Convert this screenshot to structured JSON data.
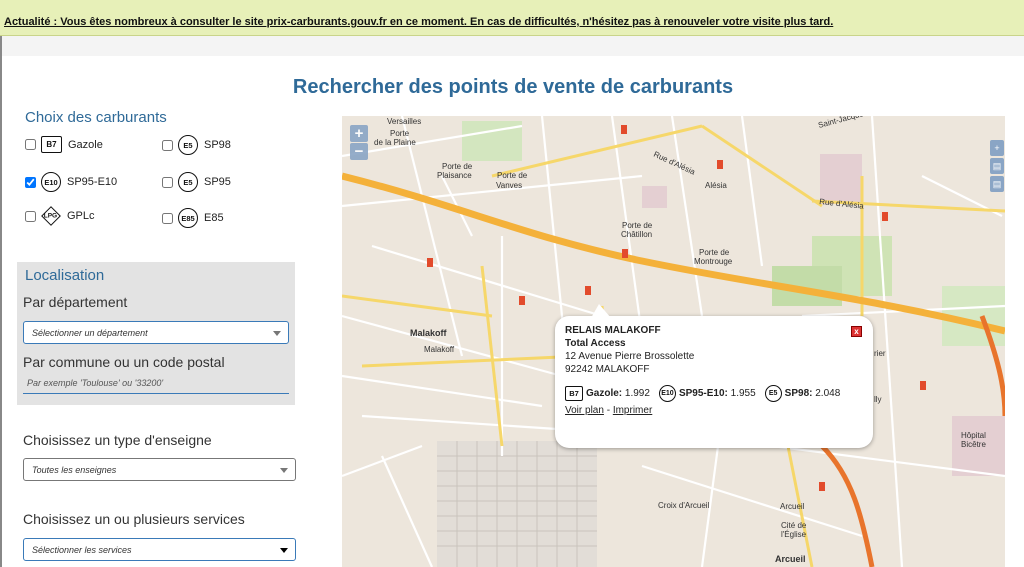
{
  "banner": "Actualité : Vous êtes nombreux à consulter le site prix-carburants.gouv.fr en ce moment. En cas de difficultés, n'hésitez pas à renouveler votre visite plus tard.",
  "page_title": "Rechercher des points de vente de carburants",
  "fuels": {
    "title": "Choix des carburants",
    "items": [
      {
        "badge": "B7",
        "label": "Gazole",
        "checked": false,
        "shape": "rect"
      },
      {
        "badge": "E5",
        "label": "SP98",
        "checked": false,
        "shape": "circle"
      },
      {
        "badge": "E10",
        "label": "SP95-E10",
        "checked": true,
        "shape": "circle"
      },
      {
        "badge": "E5",
        "label": "SP95",
        "checked": false,
        "shape": "circle"
      },
      {
        "badge": "LPG",
        "label": "GPLc",
        "checked": false,
        "shape": "diamond"
      },
      {
        "badge": "E85",
        "label": "E85",
        "checked": false,
        "shape": "circle"
      }
    ]
  },
  "localisation": {
    "title": "Localisation",
    "dept_label": "Par département",
    "dept_select": "Sélectionner un département",
    "commune_label": "Par commune ou un code postal",
    "commune_placeholder": "Par exemple 'Toulouse' ou '33200'"
  },
  "enseigne": {
    "label": "Choisissez un type d'enseigne",
    "select": "Toutes les enseignes"
  },
  "services": {
    "label": "Choisissez un ou plusieurs services",
    "select": "Sélectionner les services"
  },
  "map": {
    "zoom_in": "+",
    "zoom_out": "−",
    "places": [
      "Versailles",
      "Porte de la Plaine",
      "Porte de Plaisance",
      "Porte de Vanves",
      "Rue d'Alésia",
      "Alésia",
      "Rue d'Alésia",
      "Saint-Jacques",
      "Porte de Châtillon",
      "Porte de Montrouge",
      "Malakoff",
      "Malakoff",
      "Hôpital Bicêtre",
      "Croix d'Arcueil",
      "Arcueil",
      "Cité de l'Église",
      "Arcueil",
      "lly",
      "rier"
    ]
  },
  "popup": {
    "name": "RELAIS MALAKOFF",
    "brand": "Total Access",
    "address": "12 Avenue Pierre Brossolette",
    "city": "92242 MALAKOFF",
    "prices": [
      {
        "badge": "B7",
        "fuel": "Gazole:",
        "price": "1.992",
        "shape": "rect"
      },
      {
        "badge": "E10",
        "fuel": "SP95-E10:",
        "price": "1.955",
        "shape": "circle"
      },
      {
        "badge": "E5",
        "fuel": "SP98:",
        "price": "2.048",
        "shape": "circle"
      }
    ],
    "plan_link": "Voir plan",
    "separator": "-",
    "print_link": "Imprimer",
    "close": "x"
  },
  "colors": {
    "accent": "#2f6a98",
    "banner_bg": "#e7f0b8",
    "road_major": "#f4b13a"
  }
}
